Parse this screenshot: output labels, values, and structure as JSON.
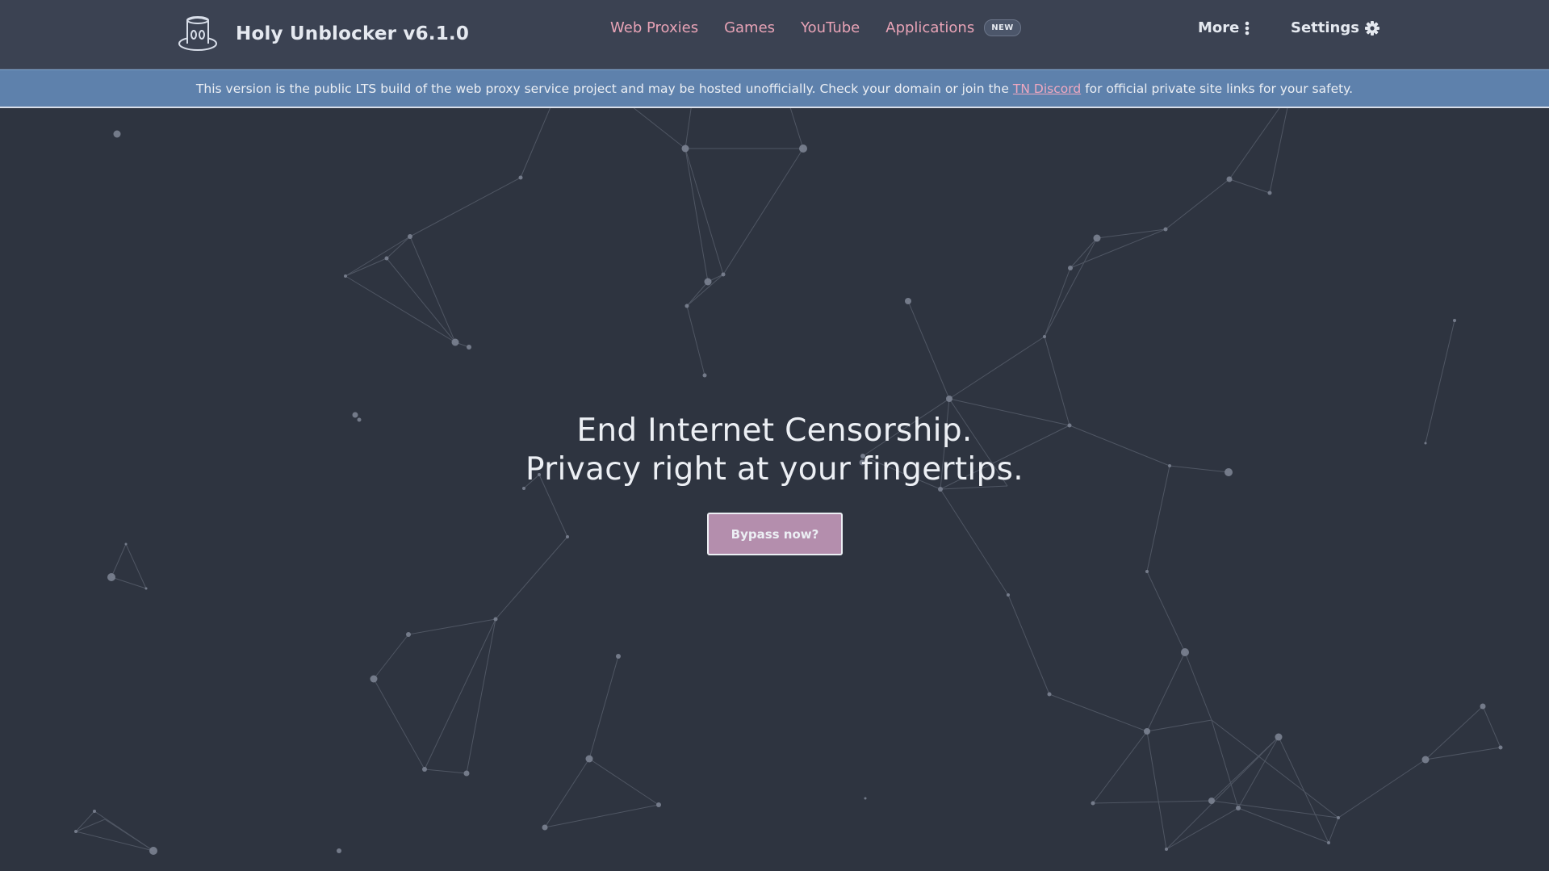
{
  "brand": {
    "title": "Holy Unblocker v6.1.0",
    "logo_icon": "top-hat-icon"
  },
  "nav": {
    "links": [
      {
        "label": "Web Proxies"
      },
      {
        "label": "Games"
      },
      {
        "label": "YouTube"
      },
      {
        "label": "Applications",
        "badge": "NEW"
      }
    ],
    "more_label": "More",
    "more_icon": "vertical-ellipsis-icon",
    "settings_label": "Settings",
    "settings_icon": "gear-icon"
  },
  "banner": {
    "text_before": "This version is the public LTS build of the web proxy service project and may be hosted unofficially. Check your domain or join the",
    "link_text": "TN Discord",
    "text_after": "for official private site links for your safety."
  },
  "hero": {
    "line1": "End Internet Censorship.",
    "line2": "Privacy right at your fingertips.",
    "button_label": "Bypass now?"
  },
  "colors": {
    "background": "#2e3440",
    "navbar": "#3b4252",
    "banner": "#5e81ac",
    "accent_link": "#e8a3b6",
    "button": "#b48ead"
  }
}
